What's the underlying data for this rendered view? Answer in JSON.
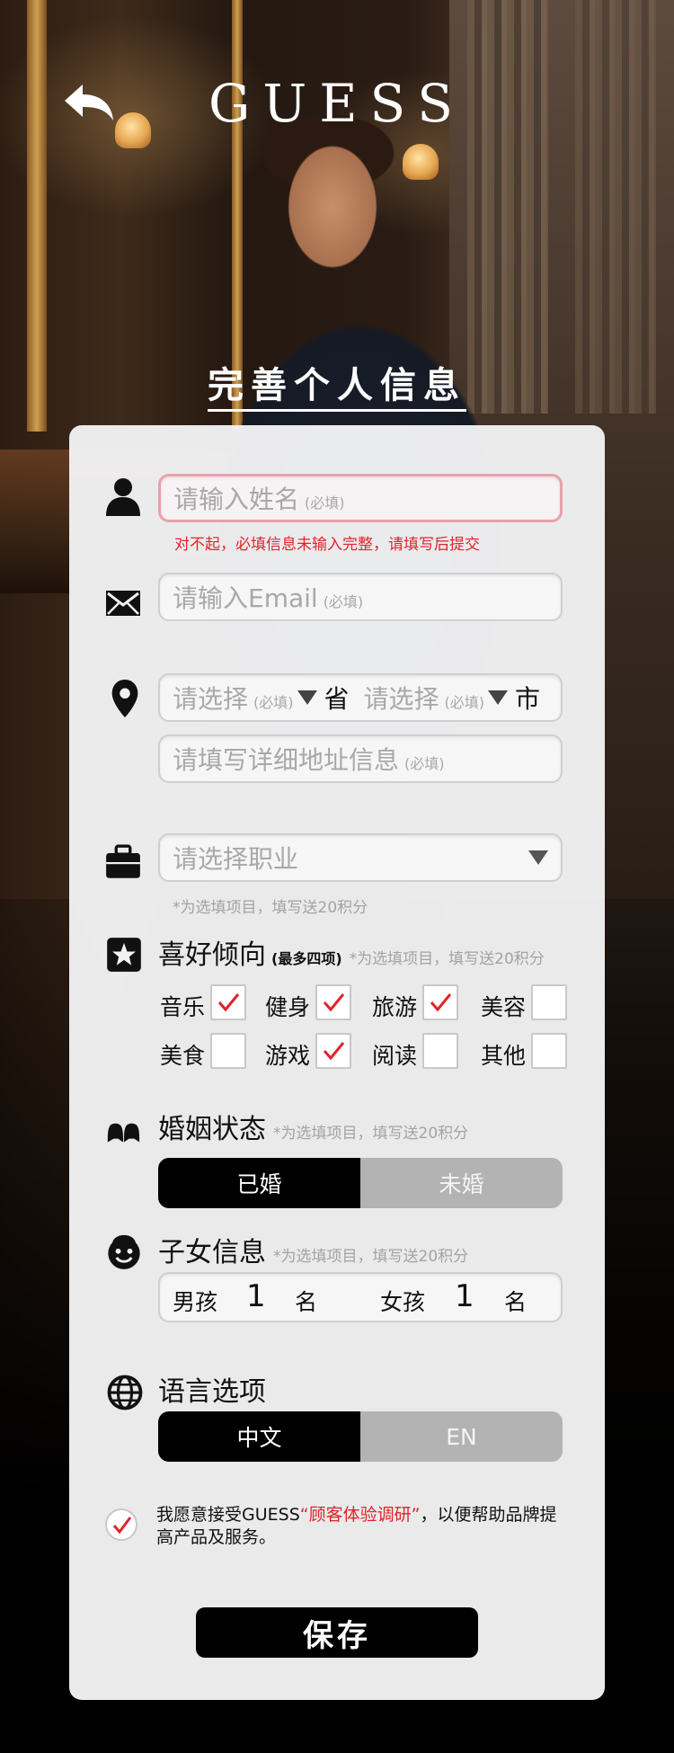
{
  "header": {
    "logo": "GUESS",
    "title": "完善个人信息"
  },
  "form": {
    "name": {
      "placeholder": "请输入姓名",
      "required": "(必填)",
      "error": "对不起，必填信息未输入完整，请填写后提交"
    },
    "email": {
      "placeholder": "请输入Email",
      "required": "(必填)"
    },
    "region": {
      "province_placeholder": "请选择",
      "province_required": "(必填)",
      "province_suffix": "省",
      "city_placeholder": "请选择",
      "city_required": "(必填)",
      "city_suffix": "市"
    },
    "address": {
      "placeholder": "请填写详细地址信息",
      "required": "(必填)"
    },
    "job": {
      "placeholder": "请选择职业",
      "hint": "*为选填项目，填写送20积分"
    },
    "hobbies": {
      "title": "喜好倾向",
      "note": "(最多四项)",
      "hint": "*为选填项目，填写送20积分",
      "options": [
        {
          "label": "音乐",
          "checked": true
        },
        {
          "label": "健身",
          "checked": true
        },
        {
          "label": "旅游",
          "checked": true
        },
        {
          "label": "美容",
          "checked": false
        },
        {
          "label": "美食",
          "checked": false
        },
        {
          "label": "游戏",
          "checked": true
        },
        {
          "label": "阅读",
          "checked": false
        },
        {
          "label": "其他",
          "checked": false
        }
      ]
    },
    "marriage": {
      "title": "婚姻状态",
      "hint": "*为选填项目，填写送20积分",
      "options": [
        "已婚",
        "未婚"
      ],
      "selected": "已婚"
    },
    "children": {
      "title": "子女信息",
      "hint": "*为选填项目，填写送20积分",
      "boy_label": "男孩",
      "boy_count": "1",
      "girl_label": "女孩",
      "girl_count": "1",
      "unit": "名"
    },
    "language": {
      "title": "语言选项",
      "options": [
        "中文",
        "EN"
      ],
      "selected": "中文"
    },
    "agreement": {
      "checked": true,
      "text_before": "我愿意接受GUESS",
      "link": "“顾客体验调研”",
      "text_after": "，以便帮助品牌提高产品及服务。"
    },
    "save_label": "保存"
  },
  "colors": {
    "error": "#e2232a",
    "active": "#000000",
    "inactive": "#b3b3b3",
    "check": "#e2232a"
  },
  "icons": [
    "back-arrow-icon",
    "user-icon",
    "mail-icon",
    "location-pin-icon",
    "briefcase-icon",
    "star-icon",
    "couple-icon",
    "child-face-icon",
    "globe-icon",
    "checkmark-icon",
    "dropdown-caret-icon"
  ]
}
